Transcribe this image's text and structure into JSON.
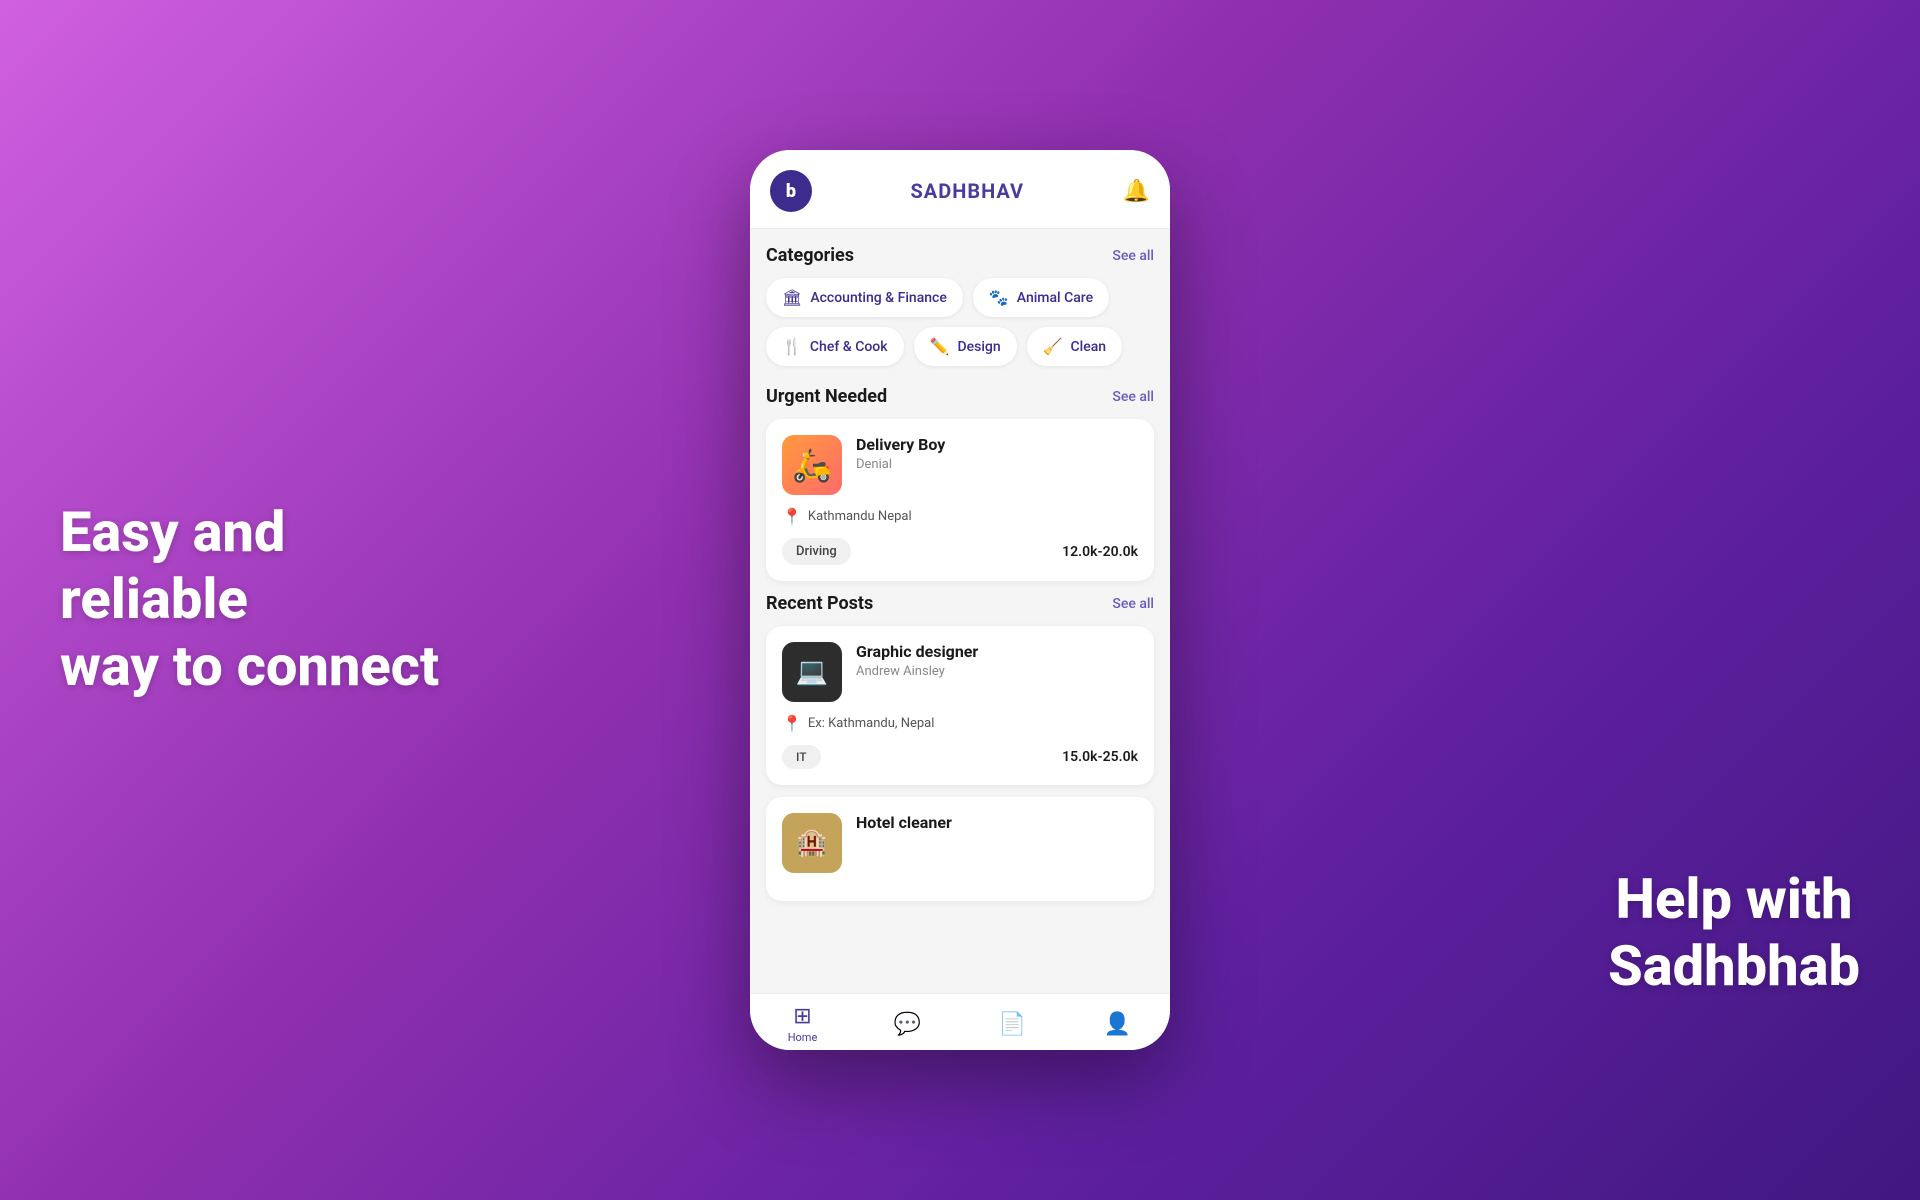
{
  "left_slogan": {
    "line1": "Easy and reliable",
    "line2": "way to connect"
  },
  "right_slogan": {
    "line1": "Help with",
    "line2": "Sadhbhab"
  },
  "header": {
    "logo_letter": "b",
    "title": "SADHBHAV",
    "notification_icon": "🔔"
  },
  "categories_section": {
    "title": "Categories",
    "see_all": "See all",
    "items": [
      {
        "icon": "🏛",
        "label": "Accounting & Finance"
      },
      {
        "icon": "🐾",
        "label": "Animal Care"
      },
      {
        "icon": "🍴",
        "label": "Chef & Cook"
      },
      {
        "icon": "✏️",
        "label": "Design"
      },
      {
        "icon": "🧹",
        "label": "Clean"
      }
    ]
  },
  "urgent_section": {
    "title": "Urgent Needed",
    "see_all": "See all",
    "jobs": [
      {
        "title": "Delivery Boy",
        "subtitle": "Denial",
        "location": "Kathmandu Nepal",
        "tag": "Driving",
        "salary": "12.0k-20.0k",
        "avatar_type": "delivery"
      }
    ]
  },
  "recent_section": {
    "title": "Recent Posts",
    "see_all": "See all",
    "jobs": [
      {
        "title": "Graphic designer",
        "subtitle": "Andrew Ainsley",
        "location": "Ex: Kathmandu, Nepal",
        "tag": "IT",
        "salary": "15.0k-25.0k",
        "avatar_type": "graphic"
      },
      {
        "title": "Hotel cleaner",
        "subtitle": "",
        "location": "",
        "tag": "",
        "salary": "",
        "avatar_type": "hotel"
      }
    ]
  },
  "bottom_nav": {
    "items": [
      {
        "icon": "⊞",
        "label": "Home",
        "active": true
      },
      {
        "icon": "💬",
        "label": "",
        "active": false
      },
      {
        "icon": "📄",
        "label": "",
        "active": false
      },
      {
        "icon": "👤",
        "label": "",
        "active": false
      }
    ]
  }
}
